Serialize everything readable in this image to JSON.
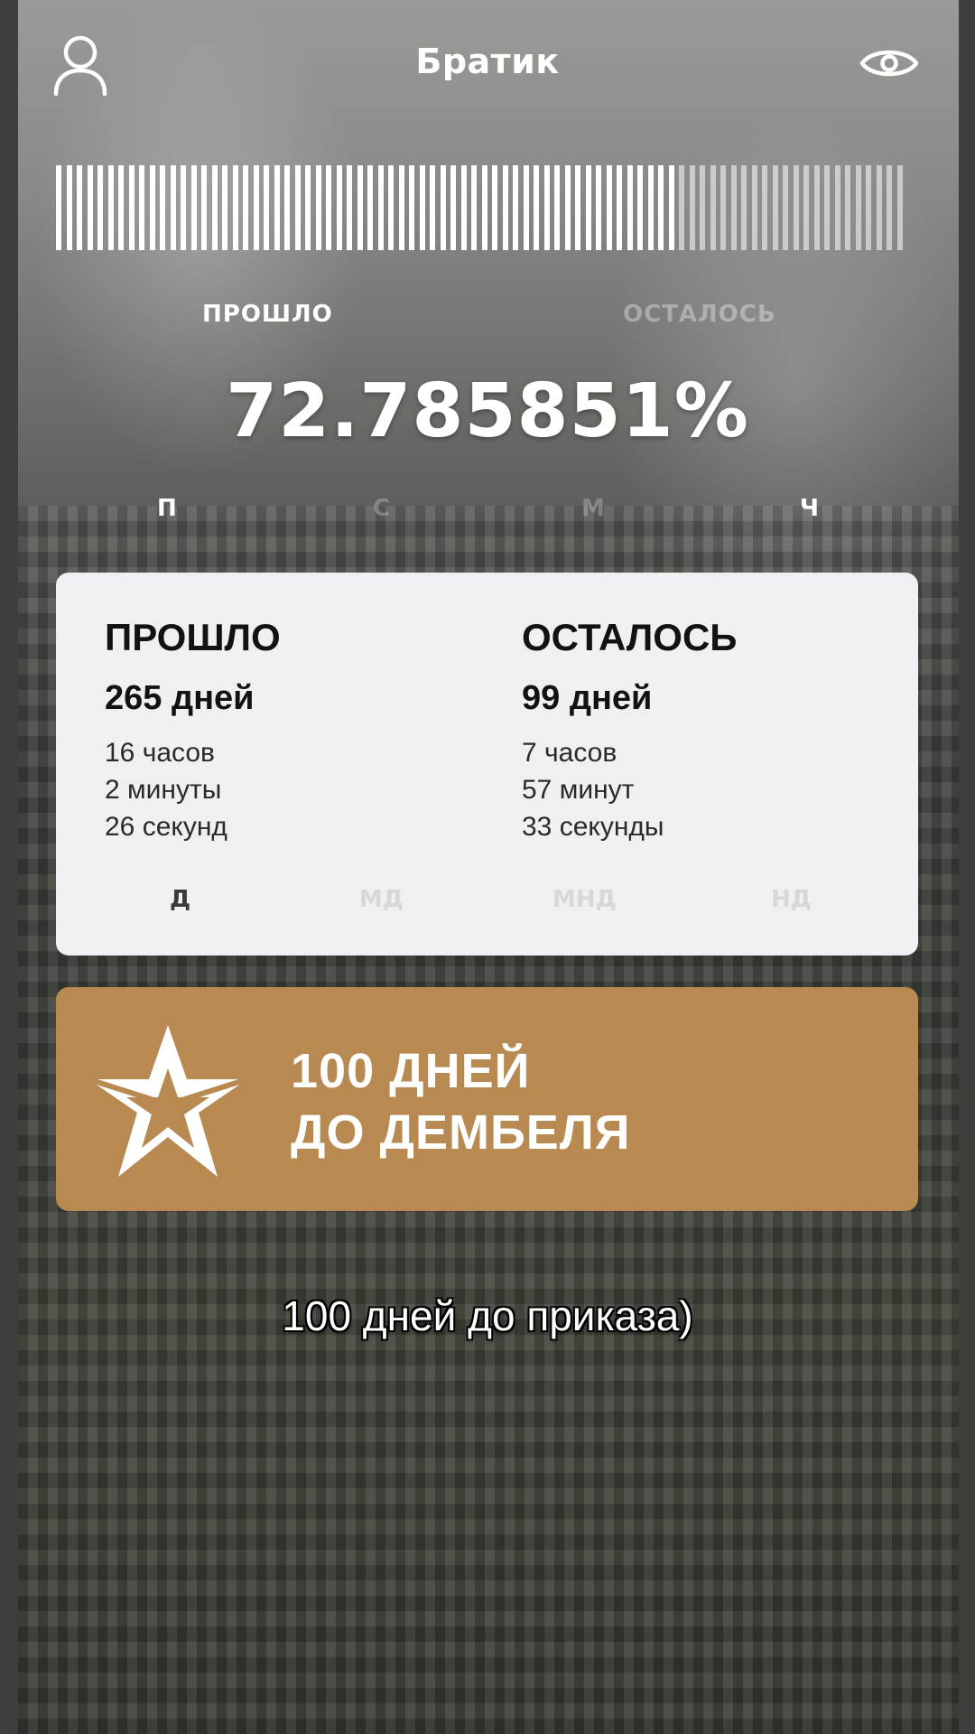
{
  "header": {
    "title": "Братик",
    "profile_icon": "person-icon",
    "visibility_icon": "eye-icon"
  },
  "progress": {
    "fraction_done": 0.727859,
    "label_passed": "ПРОШЛО",
    "label_left": "ОСТАЛОСЬ",
    "percent_text": "72.785851%"
  },
  "unit_switch_top": {
    "items": [
      "П",
      "С",
      "М",
      "Ч"
    ],
    "active": "П"
  },
  "card": {
    "passed": {
      "title": "ПРОШЛО",
      "days": "265 дней",
      "hours": "16 часов",
      "minutes": "2 минуты",
      "seconds": "26 секунд"
    },
    "left": {
      "title": "ОСТАЛОСЬ",
      "days": "99 дней",
      "hours": "7 часов",
      "minutes": "57 минут",
      "seconds": "33 секунды"
    },
    "tabs": [
      "Д",
      "МД",
      "МНД",
      "НД"
    ],
    "active_tab": "Д"
  },
  "banner": {
    "line1": "100 ДНЕЙ",
    "line2": "ДО ДЕМБЕЛЯ",
    "icon": "army-star-icon",
    "color": "#b88a52"
  },
  "caption": "100 дней до приказа)"
}
